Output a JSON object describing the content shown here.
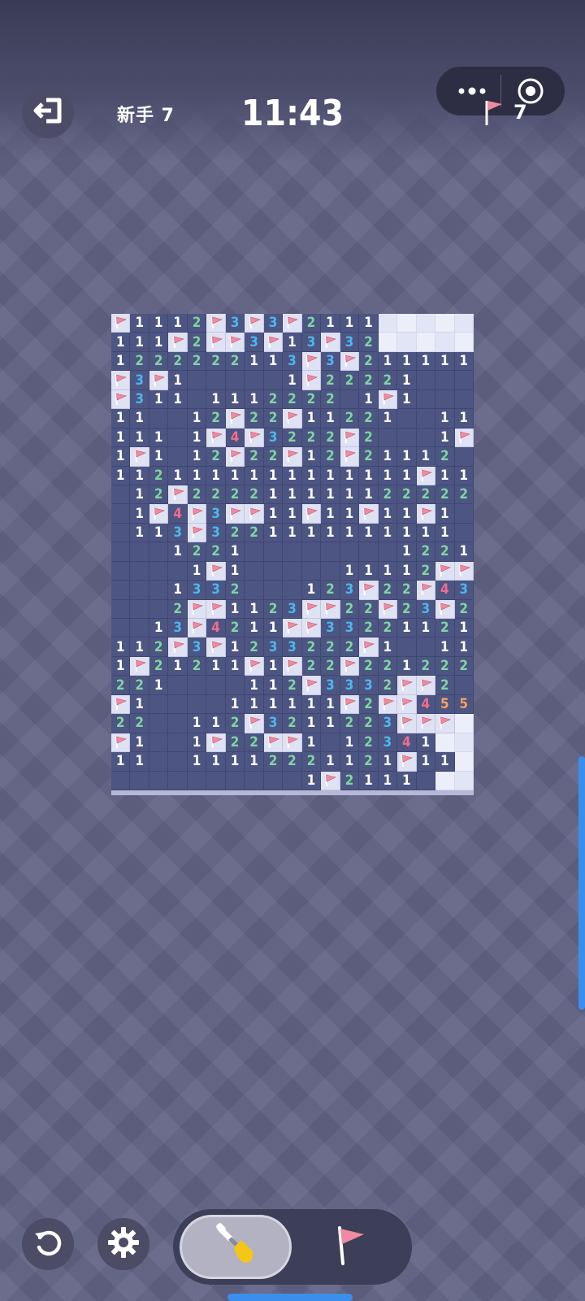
{
  "header": {
    "level_label": "新手 7",
    "timer": "11:43",
    "flags_remaining": "7",
    "exit_icon": "exit-icon",
    "more_icon": "more-dots-icon",
    "target_icon": "target-icon"
  },
  "colors": {
    "background": "#626385",
    "board_revealed": "#4d5583",
    "board_hidden": "#eceef9",
    "flag": "#f08aa0",
    "number_1": "#ffffff",
    "number_2": "#7ed6a0",
    "number_3": "#4cb8ee",
    "number_4": "#f26d8e",
    "number_5": "#f7a25c",
    "accent_blue": "#3b8fec"
  },
  "board": {
    "columns": 19,
    "rows": 25,
    "legend": {
      "F": "flagged cell",
      "#": "unrevealed cell",
      ".": "revealed empty cell",
      "1-5": "revealed number"
    },
    "cells": [
      "F1112F3F3F2111#####",
      "111F2FF3F13F32#####",
      "1222222113F3F211111",
      "F3F1.....1F22221...",
      "F311.1112222.1F1...",
      "11..12F22F11221..11",
      "111.1F4F3222F2...1F",
      "1F1.12F22F12F21112",
      "1121111111111111F11F",
      ".12F2222111111222221",
      ".1F4F3FF11F11F11F1.",
      ".113F3221111111111.",
      "...1221........1221",
      "....1F1.....11112FF1",
      "...1332...123F22F432",
      "...2FF1123FF22F23F2",
      "..13F4211FF332211212",
      "112F3F1233222F1..111",
      "1F21211F1F22F221222221",
      "221....112F3332FF2",
      "F1....111111F2FF455#",
      "22..112F3211223FFF##",
      "F1..1F22FF1.12341##",
      "11..11112221121F11##",
      "..........1F2111.##"
    ]
  },
  "controls": {
    "undo_icon": "undo-icon",
    "settings_icon": "gear-icon",
    "dig_mode_icon": "shovel-icon",
    "flag_mode_icon": "flag-icon",
    "active_mode": "dig"
  }
}
